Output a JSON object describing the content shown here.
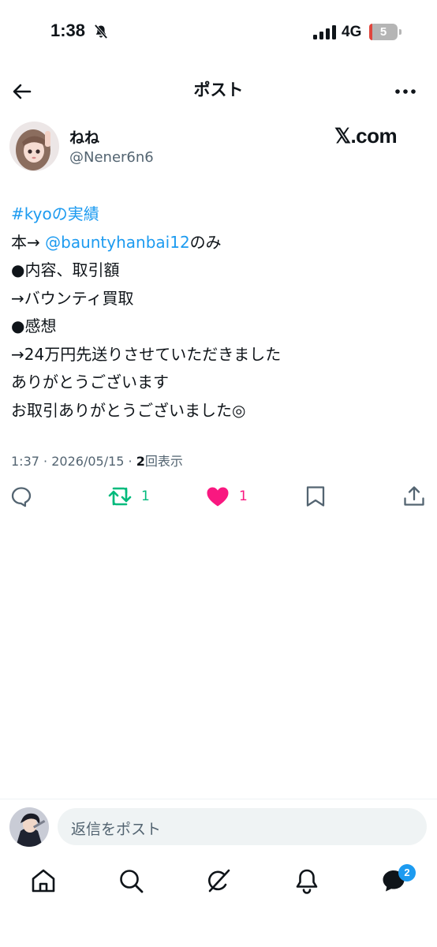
{
  "status_bar": {
    "time": "1:38",
    "network": "4G",
    "battery": "5",
    "icons": [
      "bell-slash-icon",
      "signal-bars-icon",
      "battery-icon"
    ]
  },
  "header": {
    "title": "ポスト",
    "icons": [
      "back-arrow-icon",
      "more-icon"
    ]
  },
  "author": {
    "name": "ねね",
    "handle": "@Nener6n6",
    "watermark": "𝕏.com"
  },
  "post": {
    "hashtag": "#kyoの実績",
    "line1_prefix": "本→ ",
    "mention": "@bauntyhanbai12",
    "line1_suffix": "のみ",
    "lines": [
      "●内容、取引額",
      "→バウンティ買取",
      "●感想",
      "→24万円先送りさせていただきました",
      "ありがとうございます",
      "お取引ありがとうございました◎"
    ]
  },
  "meta": {
    "time": "1:37",
    "separator": "·",
    "date": "2026/05/15",
    "views_count": "2",
    "views_label": "回表示"
  },
  "actions": {
    "reply_icon": "reply-icon",
    "retweet_icon": "retweet-icon",
    "retweet_count": "1",
    "like_icon": "heart-icon",
    "like_count": "1",
    "bookmark_icon": "bookmark-icon",
    "share_icon": "share-icon"
  },
  "reply_bar": {
    "placeholder": "返信をポスト"
  },
  "tabbar": {
    "items": [
      "home-icon",
      "search-icon",
      "grok-icon",
      "notifications-icon",
      "messages-icon"
    ],
    "messages_badge": "2"
  },
  "colors": {
    "accent": "#1d9bf0",
    "like": "#f91880",
    "retweet": "#00ba7c",
    "secondary_text": "#536471"
  }
}
